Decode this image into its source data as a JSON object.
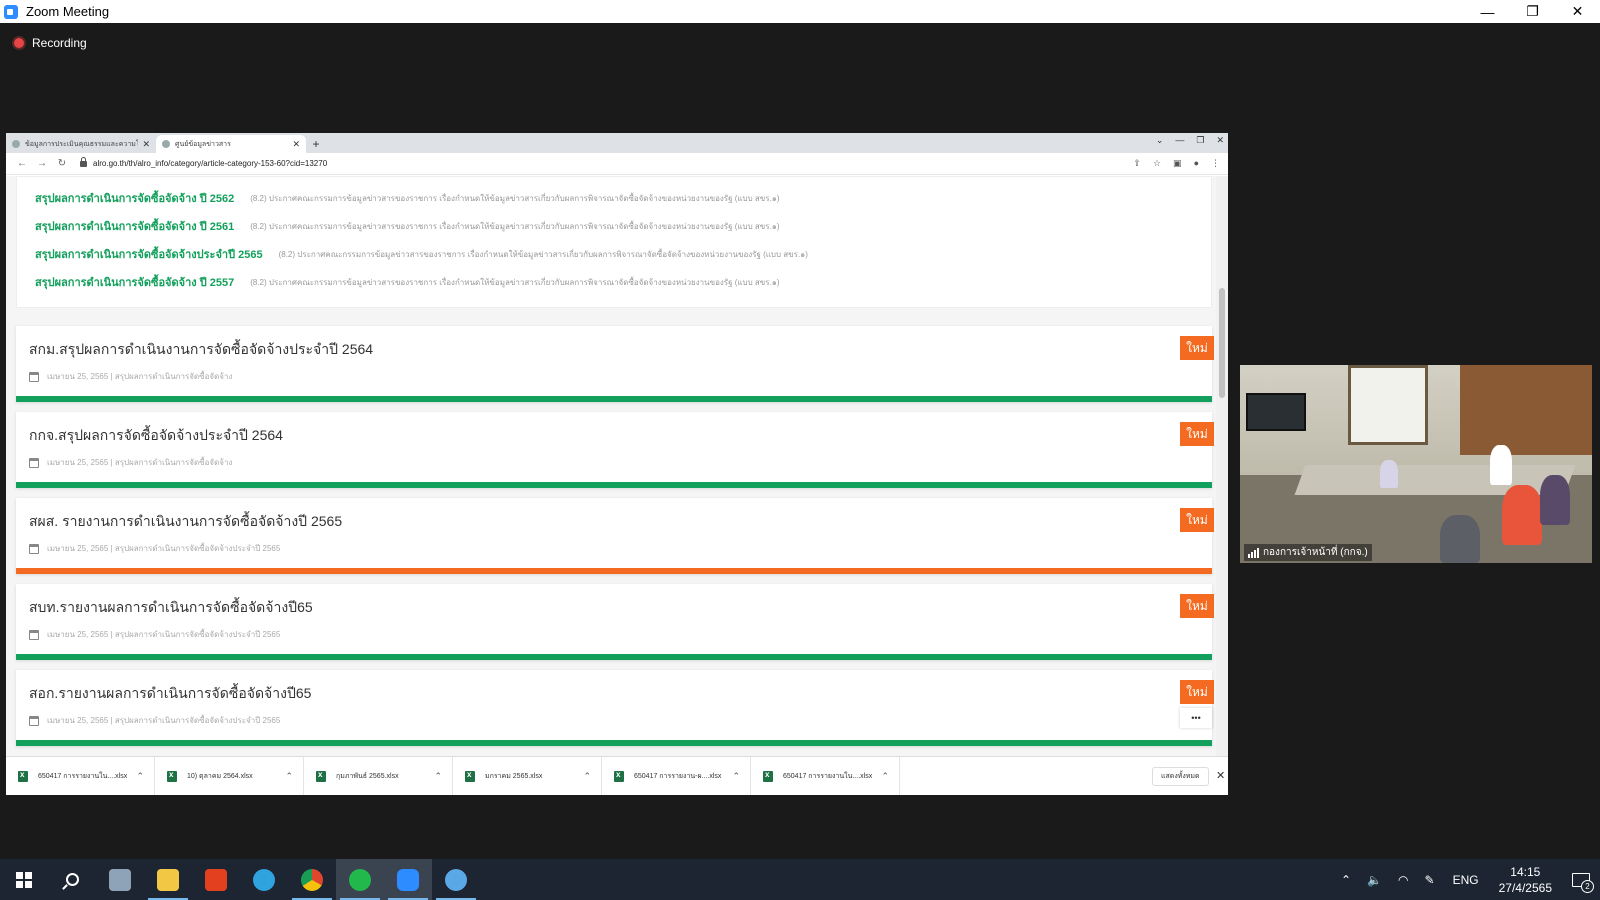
{
  "zoom": {
    "title": "Zoom Meeting",
    "recording_label": "Recording",
    "window_controls": {
      "minimize": "—",
      "restore": "❐",
      "close": "✕"
    }
  },
  "browser": {
    "tabs": [
      {
        "label": "ข้อมูลการประเมินคุณธรรมและความโปร่งใส",
        "active": false
      },
      {
        "label": "ศูนย์ข้อมูลข่าวสาร",
        "active": true
      }
    ],
    "url": "alro.go.th/th/alro_info/category/article-category-153-60?cid=13270",
    "links": [
      {
        "title": "สรุปผลการดำเนินการจัดซื้อจัดจ้าง ปี 2562",
        "desc": "(8.2) ประกาศคณะกรรมการข้อมูลข่าวสารของราชการ เรื่องกำหนดให้ข้อมูลข่าวสารเกี่ยวกับผลการพิจารณาจัดซื้อจัดจ้างของหน่วยงานของรัฐ (แบบ สขร.๑)"
      },
      {
        "title": "สรุปผลการดำเนินการจัดซื้อจัดจ้าง ปี 2561",
        "desc": "(8.2) ประกาศคณะกรรมการข้อมูลข่าวสารของราชการ เรื่องกำหนดให้ข้อมูลข่าวสารเกี่ยวกับผลการพิจารณาจัดซื้อจัดจ้างของหน่วยงานของรัฐ (แบบ สขร.๑)"
      },
      {
        "title": "สรุปผลการดำเนินการจัดซื้อจัดจ้างประจำปี 2565",
        "desc": "(8.2) ประกาศคณะกรรมการข้อมูลข่าวสารของราชการ เรื่องกำหนดให้ข้อมูลข่าวสารเกี่ยวกับผลการพิจารณาจัดซื้อจัดจ้างของหน่วยงานของรัฐ (แบบ สขร.๑)"
      },
      {
        "title": "สรุปผลการดำเนินการจัดซื้อจัดจ้าง ปี 2557",
        "desc": "(8.2) ประกาศคณะกรรมการข้อมูลข่าวสารของราชการ เรื่องกำหนดให้ข้อมูลข่าวสารเกี่ยวกับผลการพิจารณาจัดซื้อจัดจ้างของหน่วยงานของรัฐ (แบบ สขร.๑)"
      }
    ],
    "cards": [
      {
        "title": "สกม.สรุปผลการดำเนินงานการจัดซื้อจัดจ้างประจำปี 2564",
        "meta": "เมษายน 25, 2565 | สรุปผลการดำเนินการจัดซื้อจัดจ้าง",
        "badge": "ใหม่",
        "bar_color": "#13a05c"
      },
      {
        "title": "กกจ.สรุปผลการจัดซื้อจัดจ้างประจำปี 2564",
        "meta": "เมษายน 25, 2565 | สรุปผลการดำเนินการจัดซื้อจัดจ้าง",
        "badge": "ใหม่",
        "bar_color": "#13a05c"
      },
      {
        "title": "สผส. รายงานการดำเนินงานการจัดซื้อจัดจ้างปี 2565",
        "meta": "เมษายน 25, 2565 | สรุปผลการดำเนินการจัดซื้อจัดจ้างประจำปี 2565",
        "badge": "ใหม่",
        "bar_color": "#f46a20"
      },
      {
        "title": "สบท.รายงานผลการดำเนินการจัดซื้อจัดจ้างปี65",
        "meta": "เมษายน 25, 2565 | สรุปผลการดำเนินการจัดซื้อจัดจ้างประจำปี 2565",
        "badge": "ใหม่",
        "bar_color": "#13a05c"
      },
      {
        "title": "สอก.รายงานผลการดำเนินการจัดซื้อจัดจ้างปี65",
        "meta": "เมษายน 25, 2565 | สรุปผลการดำเนินการจัดซื้อจัดจ้างประจำปี 2565",
        "badge": "ใหม่",
        "bar_color": "#13a05c"
      }
    ],
    "more_label": "•••",
    "downloads": [
      {
        "name": "650417 การรายงานใน....xlsx"
      },
      {
        "name": "10) ตุลาคม 2564.xlsx"
      },
      {
        "name": "กุมภาพันธ์ 2565.xlsx"
      },
      {
        "name": "มกราคม 2565.xlsx"
      },
      {
        "name": "650417 การรายงาน-ผ....xlsx"
      },
      {
        "name": "650417 การรายงานใน....xlsx"
      }
    ],
    "show_all_label": "แสดงทั้งหมด"
  },
  "participant": {
    "name": "กองการเจ้าหน้าที่ (กกจ.)"
  },
  "taskbar": {
    "apps": [
      {
        "name": "start",
        "icon": "windows-logo"
      },
      {
        "name": "search",
        "icon": "search-icon"
      },
      {
        "name": "app-1",
        "icon": "app-icon",
        "color": "#8fa3b8"
      },
      {
        "name": "file-explorer",
        "icon": "folder-icon",
        "color": "#f2c744"
      },
      {
        "name": "office",
        "icon": "office-icon",
        "color": "#e3401f"
      },
      {
        "name": "edge",
        "icon": "edge-icon",
        "color": "#2ea3dd"
      },
      {
        "name": "chrome",
        "icon": "chrome-icon",
        "color": "#e0462e"
      },
      {
        "name": "line",
        "icon": "line-icon",
        "color": "#22b94c"
      },
      {
        "name": "zoom",
        "icon": "zoom-icon",
        "color": "#2d8cff"
      },
      {
        "name": "paint",
        "icon": "paint-icon",
        "color": "#5aa9e6"
      }
    ],
    "language": "ENG",
    "time": "14:15",
    "date": "27/4/2565",
    "notification_count": "2"
  }
}
